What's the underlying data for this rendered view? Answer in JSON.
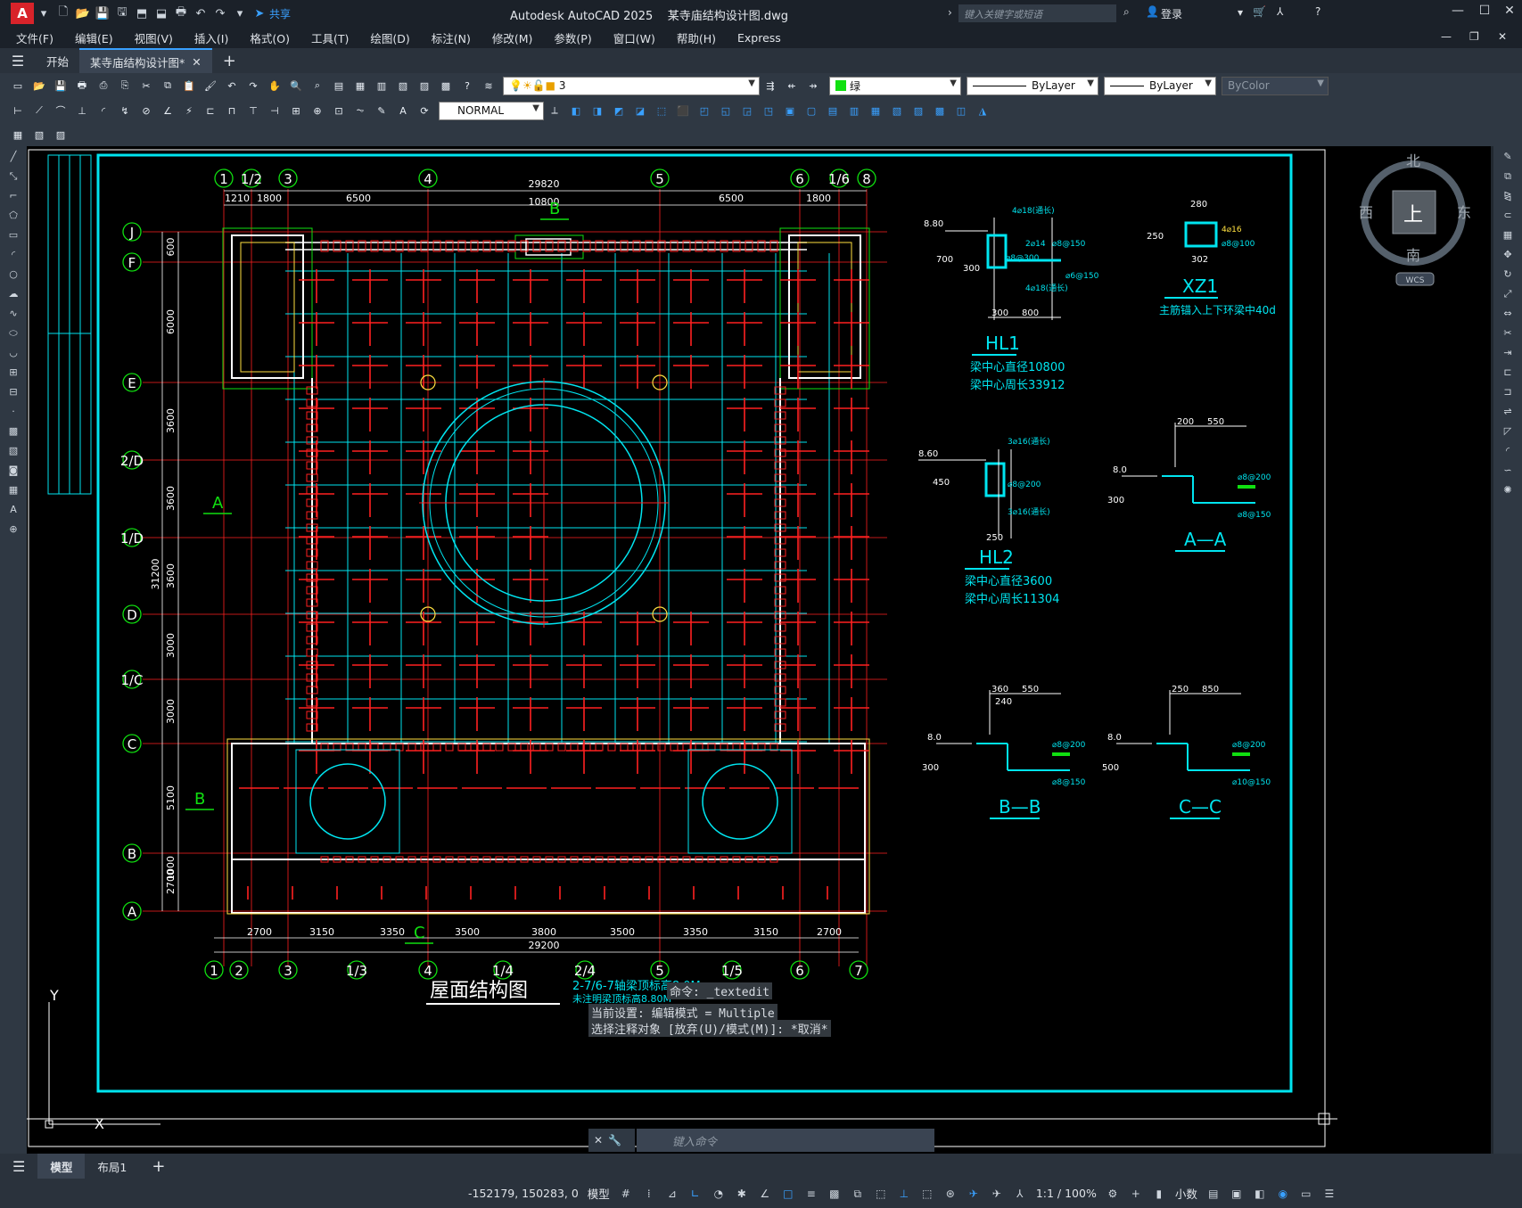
{
  "app": {
    "title": "Autodesk AutoCAD 2025",
    "filename": "某寺庙结构设计图.dwg",
    "share": "共享",
    "search_placeholder": "键入关键字或短语",
    "login": "登录"
  },
  "menu": [
    "文件(F)",
    "编辑(E)",
    "视图(V)",
    "插入(I)",
    "格式(O)",
    "工具(T)",
    "绘图(D)",
    "标注(N)",
    "修改(M)",
    "参数(P)",
    "窗口(W)",
    "帮助(H)",
    "Express"
  ],
  "tabs": {
    "start": "开始",
    "doc": "某寺庙结构设计图*"
  },
  "props": {
    "layer": "3",
    "color": "绿",
    "linetype": "ByLayer",
    "lineweight": "ByLayer",
    "plotstyle": "ByColor",
    "textstyle": "NORMAL"
  },
  "viewcube": {
    "north": "北",
    "south": "南",
    "east": "东",
    "west": "西",
    "top": "上",
    "wcs": "WCS"
  },
  "drawing": {
    "title": "屋面结构图",
    "note1": "2-7/6-7轴梁顶标高8.0M",
    "note2": "未注明梁顶标高8.80M",
    "dim_total_top": "29820",
    "dim_inner_top": "10800",
    "dim_top": [
      "1210",
      "1800",
      "6500",
      "6500",
      "1800"
    ],
    "dim_bottom": [
      "2700",
      "3150",
      "3350",
      "3500",
      "3800",
      "3500",
      "3350",
      "3150",
      "2700"
    ],
    "dim_total_bottom": "29200",
    "dim_left": [
      "600",
      "6000",
      "3600",
      "3600",
      "3600",
      "3000",
      "3000",
      "5100",
      "2700",
      "1000"
    ],
    "dim_left_total": "31200",
    "axes_top": [
      "1",
      "1/2",
      "3",
      "4",
      "5",
      "6",
      "1/6",
      "8"
    ],
    "axes_bottom": [
      "1",
      "2",
      "3",
      "1/3",
      "4",
      "1/4",
      "2/4",
      "5",
      "1/5",
      "6",
      "7"
    ],
    "axes_left": [
      "J",
      "F",
      "E",
      "2/D",
      "1/D",
      "D",
      "1/C",
      "C",
      "B",
      "A"
    ],
    "section_marks": [
      "A",
      "B",
      "B",
      "C"
    ],
    "details": {
      "hl1": {
        "name": "HL1",
        "l1": "梁中心直径10800",
        "l2": "梁中心周长33912",
        "el": "8.80",
        "d1": "700",
        "d2": "300",
        "d3": "800",
        "r1": "4⌀18(通长)",
        "r2": "2⌀14",
        "r3": "⌀8@150",
        "r4": "⌀8@300",
        "r5": "4⌀18(通长)",
        "r6": "⌀6@150",
        "w1": "300",
        "w2": "800"
      },
      "xz1": {
        "name": "XZ1",
        "note": "主筋锚入上下环梁中40d",
        "w": "280",
        "h": "250",
        "bot": "302",
        "r1": "4⌀16",
        "r2": "⌀8@100"
      },
      "hl2": {
        "name": "HL2",
        "l1": "梁中心直径3600",
        "l2": "梁中心周长11304",
        "el": "8.60",
        "d": "450",
        "w": "250",
        "r1": "3⌀16(通长)",
        "r2": "⌀8@200",
        "r3": "3⌀16(通长)"
      },
      "aa": {
        "name": "A—A",
        "el": "8.0",
        "w1": "200",
        "w2": "550",
        "d": "300",
        "r1": "⌀8@200",
        "r2": "⌀8@150"
      },
      "bb": {
        "name": "B—B",
        "el": "8.0",
        "w1": "360",
        "w2": "550",
        "w3": "240",
        "d": "300",
        "r1": "⌀8@200",
        "r2": "⌀8@150"
      },
      "cc": {
        "name": "C—C",
        "el": "8.0",
        "w1": "250",
        "w2": "850",
        "d": "500",
        "r1": "⌀8@200",
        "r2": "⌀10@150"
      }
    }
  },
  "command": {
    "hist1": "命令: _textedit",
    "hist2": "当前设置: 编辑模式 = Multiple",
    "hist3": "选择注释对象 [放弃(U)/模式(M)]: *取消*",
    "placeholder": "键入命令"
  },
  "layouts": {
    "model": "模型",
    "layout1": "布局1"
  },
  "status": {
    "coords": "-152179, 150283, 0",
    "model": "模型",
    "scale": "1:1 / 100%",
    "units": "小数"
  },
  "colors": {
    "cyan": "#00e5f0",
    "red": "#ff2020",
    "white": "#ffffff",
    "green": "#10e010",
    "yellow": "#ffe040"
  }
}
